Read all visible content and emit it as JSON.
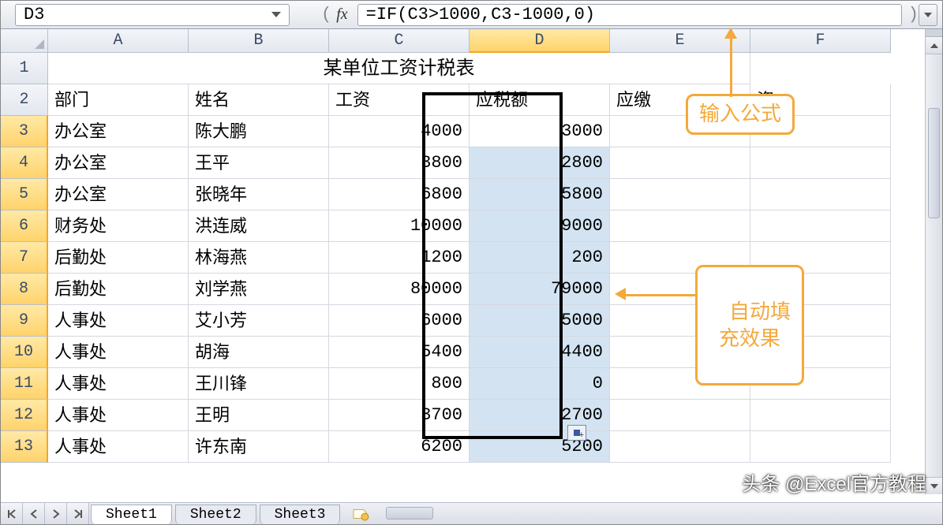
{
  "name_box": "D3",
  "fx_label": "fx",
  "formula": "=IF(C3>1000,C3-1000,0)",
  "columns": [
    "A",
    "B",
    "C",
    "D",
    "E",
    "F"
  ],
  "active_column_index": 3,
  "row_numbers": [
    1,
    2,
    3,
    4,
    5,
    6,
    7,
    8,
    9,
    10,
    11,
    12,
    13
  ],
  "active_row_start": 3,
  "active_row_end": 13,
  "title_merged": "某单位工资计税表",
  "headers": {
    "A": "部门",
    "B": "姓名",
    "C": "工资",
    "D": "应税额",
    "E": "应缴",
    "F": "资"
  },
  "rows": [
    {
      "A": "办公室",
      "B": "陈大鹏",
      "C": "4000",
      "D": "3000"
    },
    {
      "A": "办公室",
      "B": "王平",
      "C": "3800",
      "D": "2800"
    },
    {
      "A": "办公室",
      "B": "张晓年",
      "C": "6800",
      "D": "5800"
    },
    {
      "A": "财务处",
      "B": "洪连威",
      "C": "10000",
      "D": "9000"
    },
    {
      "A": "后勤处",
      "B": "林海燕",
      "C": "1200",
      "D": "200"
    },
    {
      "A": "后勤处",
      "B": "刘学燕",
      "C": "80000",
      "D": "79000"
    },
    {
      "A": "人事处",
      "B": "艾小芳",
      "C": "6000",
      "D": "5000"
    },
    {
      "A": "人事处",
      "B": "胡海",
      "C": "5400",
      "D": "4400"
    },
    {
      "A": "人事处",
      "B": "王川锋",
      "C": "800",
      "D": "0"
    },
    {
      "A": "人事处",
      "B": "王明",
      "C": "3700",
      "D": "2700"
    },
    {
      "A": "人事处",
      "B": "许东南",
      "C": "6200",
      "D": "5200"
    }
  ],
  "sheets": [
    "Sheet1",
    "Sheet2",
    "Sheet3"
  ],
  "active_sheet": 0,
  "callout_formula": "输入公式",
  "callout_fill": "自动填\n充效果",
  "watermark": "头条 @Excel官方教程"
}
